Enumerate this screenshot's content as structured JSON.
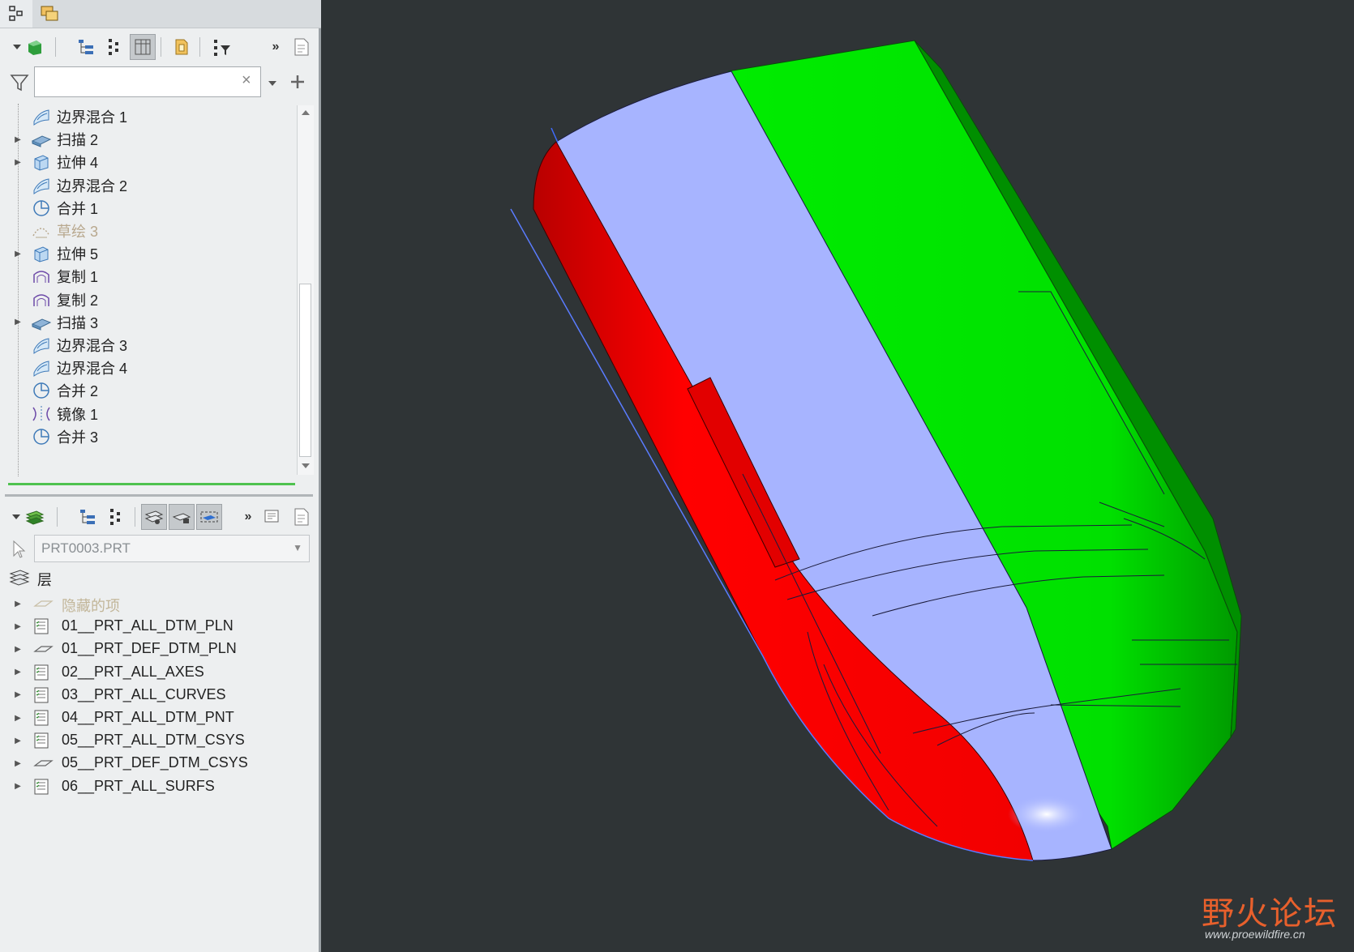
{
  "model_tree": {
    "search": {
      "placeholder": "",
      "value": ""
    },
    "items": [
      {
        "label": "边界混合 1",
        "type": "boundary-blend",
        "expandable": false,
        "suppressed": false
      },
      {
        "label": "扫描 2",
        "type": "sweep",
        "expandable": true,
        "suppressed": false
      },
      {
        "label": "拉伸 4",
        "type": "extrude",
        "expandable": true,
        "suppressed": false
      },
      {
        "label": "边界混合 2",
        "type": "boundary-blend",
        "expandable": false,
        "suppressed": false
      },
      {
        "label": "合并 1",
        "type": "merge",
        "expandable": false,
        "suppressed": false
      },
      {
        "label": "草绘 3",
        "type": "sketch",
        "expandable": false,
        "suppressed": true
      },
      {
        "label": "拉伸 5",
        "type": "extrude",
        "expandable": true,
        "suppressed": false
      },
      {
        "label": "复制 1",
        "type": "copy",
        "expandable": false,
        "suppressed": false
      },
      {
        "label": "复制 2",
        "type": "copy",
        "expandable": false,
        "suppressed": false
      },
      {
        "label": "扫描 3",
        "type": "sweep",
        "expandable": true,
        "suppressed": false
      },
      {
        "label": "边界混合 3",
        "type": "boundary-blend",
        "expandable": false,
        "suppressed": false
      },
      {
        "label": "边界混合 4",
        "type": "boundary-blend",
        "expandable": false,
        "suppressed": false
      },
      {
        "label": "合并 2",
        "type": "merge",
        "expandable": false,
        "suppressed": false
      },
      {
        "label": "镜像 1",
        "type": "mirror",
        "expandable": false,
        "suppressed": false
      },
      {
        "label": "合并 3",
        "type": "merge",
        "expandable": false,
        "suppressed": false
      }
    ]
  },
  "layer_tree": {
    "model": "PRT0003.PRT",
    "root_label": "层",
    "items": [
      {
        "label": "隐藏的项",
        "hidden": true
      },
      {
        "label": "01__PRT_ALL_DTM_PLN",
        "hidden": false
      },
      {
        "label": "01__PRT_DEF_DTM_PLN",
        "hidden": false
      },
      {
        "label": "02__PRT_ALL_AXES",
        "hidden": false
      },
      {
        "label": "03__PRT_ALL_CURVES",
        "hidden": false
      },
      {
        "label": "04__PRT_ALL_DTM_PNT",
        "hidden": false
      },
      {
        "label": "05__PRT_ALL_DTM_CSYS",
        "hidden": false
      },
      {
        "label": "05__PRT_DEF_DTM_CSYS",
        "hidden": false
      },
      {
        "label": "06__PRT_ALL_SURFS",
        "hidden": false
      }
    ]
  },
  "viewport": {
    "background": "#2f3436",
    "surface_colors": {
      "red": "#ff0000",
      "blue": "#a7b4ff",
      "green": "#00ee00"
    }
  },
  "watermark": {
    "text": "野火论坛",
    "url": "www.proewildfire.cn"
  }
}
